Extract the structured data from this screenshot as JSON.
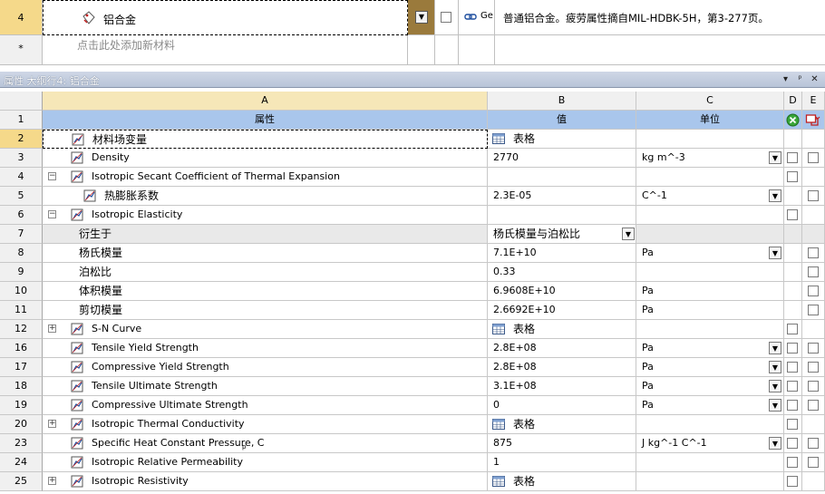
{
  "outline": {
    "material_row": {
      "num": "4",
      "name": "铝合金",
      "description": "普通铝合金。疲劳属性摘自MIL-HDBK-5H，第3-277页。",
      "source_label": "Ge"
    },
    "add_row": {
      "num": "*",
      "placeholder": "点击此处添加新材料"
    }
  },
  "properties": {
    "title": "属性 大纲行4:  铝合金",
    "pin_glyph": "ᵖ",
    "close_glyph": "✕",
    "menu_glyph": "▾",
    "columns": [
      "A",
      "B",
      "C",
      "D",
      "E"
    ],
    "headers": {
      "num": "1",
      "property": "属性",
      "value": "值",
      "unit": "单位"
    },
    "rows": [
      {
        "num": "2",
        "name": "材料场变量",
        "value": "表格",
        "unit": "",
        "indent": 0,
        "expand": "",
        "icon": "table-icon",
        "value_icon": true,
        "unit_dd": false,
        "d": false,
        "e": false,
        "gray": false
      },
      {
        "num": "3",
        "name": "Density",
        "value": "2770",
        "unit": "kg m^-3",
        "indent": 0,
        "expand": "",
        "icon": "property-icon",
        "unit_dd": true,
        "d": true,
        "e": true
      },
      {
        "num": "4",
        "name": "Isotropic Secant Coefficient of Thermal Expansion",
        "value": "",
        "unit": "",
        "indent": 0,
        "expand": "⊟",
        "icon": "property-icon",
        "d": true,
        "e": false
      },
      {
        "num": "5",
        "name": "热膨胀系数",
        "value": "2.3E-05",
        "unit": "C^-1",
        "indent": 1,
        "expand": "",
        "icon": "property-icon",
        "unit_dd": true,
        "d": false,
        "e": true
      },
      {
        "num": "6",
        "name": "Isotropic Elasticity",
        "value": "",
        "unit": "",
        "indent": 0,
        "expand": "⊟",
        "icon": "property-icon",
        "d": true,
        "e": false
      },
      {
        "num": "7",
        "name": "衍生于",
        "value": "杨氏模量与泊松比",
        "unit": "",
        "indent": 1,
        "expand": "",
        "icon": "",
        "value_dd": true,
        "gray": true
      },
      {
        "num": "8",
        "name": "杨氏模量",
        "value": "7.1E+10",
        "unit": "Pa",
        "indent": 1,
        "expand": "",
        "icon": "",
        "unit_dd": true,
        "d": false,
        "e": true
      },
      {
        "num": "9",
        "name": "泊松比",
        "value": "0.33",
        "unit": "",
        "indent": 1,
        "expand": "",
        "icon": "",
        "d": false,
        "e": true
      },
      {
        "num": "10",
        "name": "体积模量",
        "value": "6.9608E+10",
        "unit": "Pa",
        "indent": 1,
        "expand": "",
        "icon": "",
        "d": false,
        "e": true
      },
      {
        "num": "11",
        "name": "剪切模量",
        "value": "2.6692E+10",
        "unit": "Pa",
        "indent": 1,
        "expand": "",
        "icon": "",
        "d": false,
        "e": true
      },
      {
        "num": "12",
        "name": "S-N Curve",
        "value": "表格",
        "unit": "",
        "indent": 0,
        "expand": "⊞",
        "icon": "property-icon",
        "value_icon": true,
        "d": true,
        "e": false
      },
      {
        "num": "16",
        "name": "Tensile Yield Strength",
        "value": "2.8E+08",
        "unit": "Pa",
        "indent": 0,
        "expand": "",
        "icon": "property-icon",
        "unit_dd": true,
        "d": true,
        "e": true
      },
      {
        "num": "17",
        "name": "Compressive Yield Strength",
        "value": "2.8E+08",
        "unit": "Pa",
        "indent": 0,
        "expand": "",
        "icon": "property-icon",
        "unit_dd": true,
        "d": true,
        "e": true
      },
      {
        "num": "18",
        "name": "Tensile Ultimate Strength",
        "value": "3.1E+08",
        "unit": "Pa",
        "indent": 0,
        "expand": "",
        "icon": "property-icon",
        "unit_dd": true,
        "d": true,
        "e": true
      },
      {
        "num": "19",
        "name": "Compressive Ultimate Strength",
        "value": "0",
        "unit": "Pa",
        "indent": 0,
        "expand": "",
        "icon": "property-icon",
        "unit_dd": true,
        "d": true,
        "e": true
      },
      {
        "num": "20",
        "name": "Isotropic Thermal Conductivity",
        "value": "表格",
        "unit": "",
        "indent": 0,
        "expand": "⊞",
        "icon": "property-icon",
        "value_icon": true,
        "d": true,
        "e": false
      },
      {
        "num": "23",
        "name": "Specific Heat Constant Pressure, C",
        "name_sub": "p",
        "value": "875",
        "unit": "J kg^-1 C^-1",
        "indent": 0,
        "expand": "",
        "icon": "property-icon",
        "unit_dd": true,
        "d": true,
        "e": true
      },
      {
        "num": "24",
        "name": "Isotropic Relative Permeability",
        "value": "1",
        "unit": "",
        "indent": 0,
        "expand": "",
        "icon": "property-icon",
        "d": true,
        "e": true
      },
      {
        "num": "25",
        "name": "Isotropic Resistivity",
        "value": "表格",
        "unit": "",
        "indent": 0,
        "expand": "⊞",
        "icon": "property-icon",
        "value_icon": true,
        "d": true,
        "e": false
      }
    ]
  },
  "colors": {
    "header_blue": "#a9c6ec",
    "selected_col": "#f6e7b8",
    "row_selected": "#f5d98a",
    "panel_title": "#bcc7da"
  }
}
